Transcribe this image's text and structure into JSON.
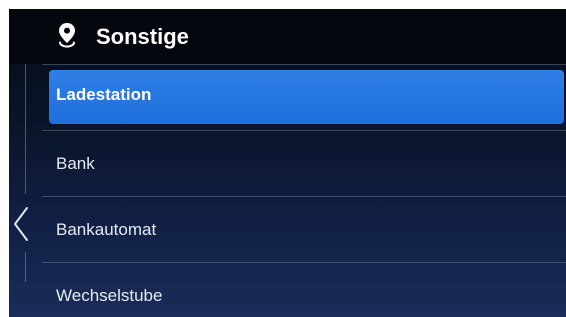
{
  "header": {
    "title": "Sonstige",
    "icon": "location-pin-icon"
  },
  "nav": {
    "back_icon": "chevron-left-icon"
  },
  "list": {
    "selected_index": 0,
    "items": [
      {
        "label": "Ladestation"
      },
      {
        "label": "Bank"
      },
      {
        "label": "Bankautomat"
      },
      {
        "label": "Wechselstube"
      }
    ]
  },
  "colors": {
    "accent": "#1f6fdc",
    "background_top": "#050a14",
    "background_bottom": "#1a2c58",
    "text": "#e6ebf3"
  }
}
